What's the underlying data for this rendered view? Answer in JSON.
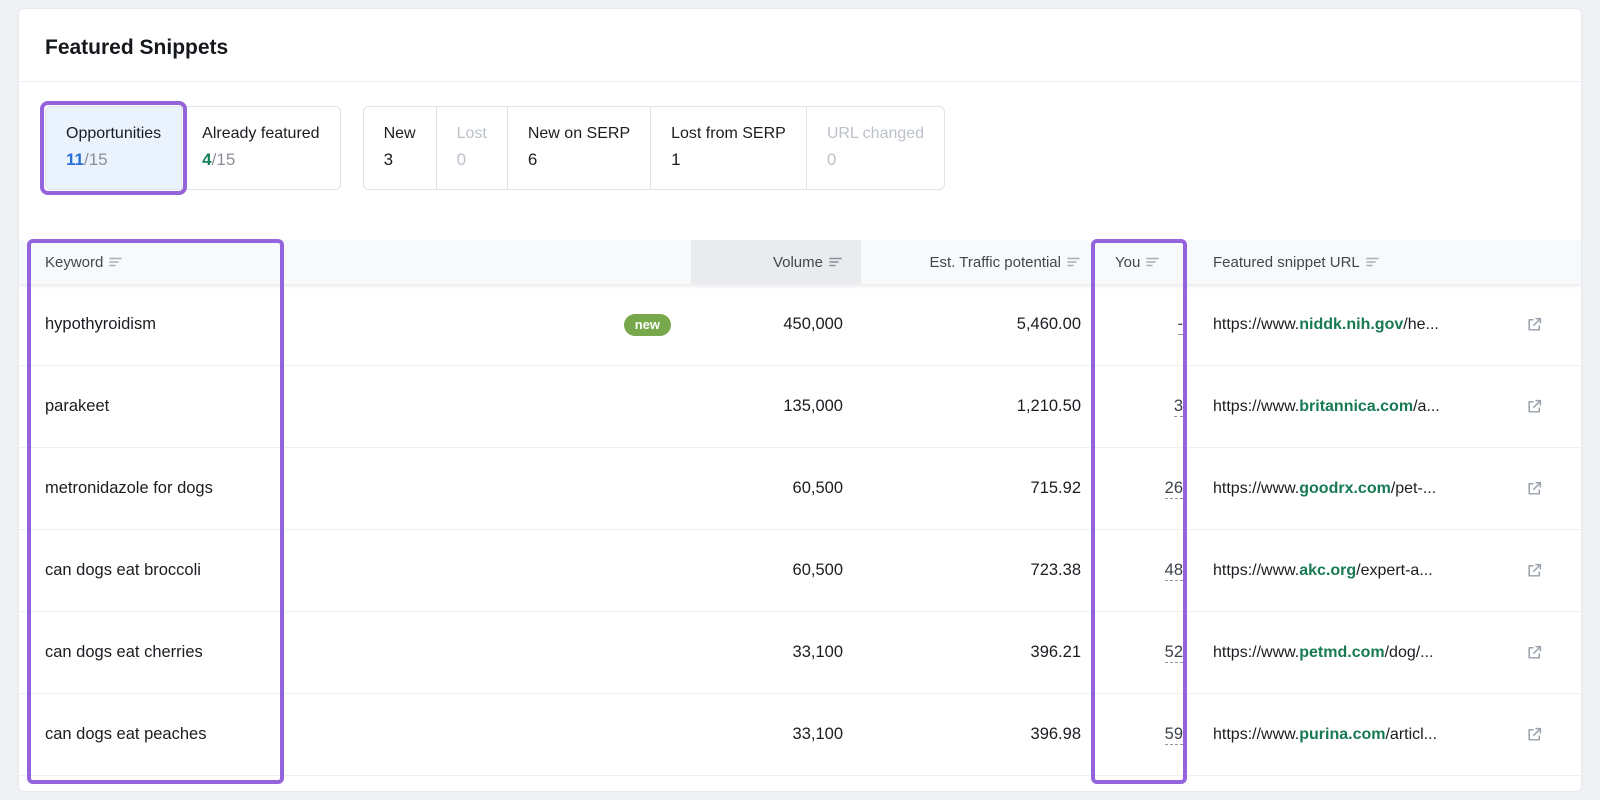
{
  "page": {
    "title": "Featured Snippets"
  },
  "tabs": [
    {
      "label": "Opportunities",
      "count": "11",
      "total": "/15"
    },
    {
      "label": "Already featured",
      "count": "4",
      "total": "/15"
    }
  ],
  "filters": [
    {
      "label": "New",
      "count": "3"
    },
    {
      "label": "Lost",
      "count": "0"
    },
    {
      "label": "New on SERP",
      "count": "6"
    },
    {
      "label": "Lost from SERP",
      "count": "1"
    },
    {
      "label": "URL changed",
      "count": "0"
    }
  ],
  "table": {
    "headers": {
      "keyword": "Keyword",
      "volume": "Volume",
      "traffic": "Est. Traffic potential",
      "you": "You",
      "url": "Featured snippet URL"
    },
    "rows": [
      {
        "keyword": "hypothyroidism",
        "badge": "new",
        "volume": "450,000",
        "traffic": "5,460.00",
        "you": "-",
        "url_prefix": "https://www.",
        "domain": "niddk.nih.gov",
        "path": "/he..."
      },
      {
        "keyword": "parakeet",
        "volume": "135,000",
        "traffic": "1,210.50",
        "you": "3",
        "url_prefix": "https://www.",
        "domain": "britannica.com",
        "path": "/a..."
      },
      {
        "keyword": "metronidazole for dogs",
        "volume": "60,500",
        "traffic": "715.92",
        "you": "26",
        "url_prefix": "https://www.",
        "domain": "goodrx.com",
        "path": "/pet-..."
      },
      {
        "keyword": "can dogs eat broccoli",
        "volume": "60,500",
        "traffic": "723.38",
        "you": "48",
        "url_prefix": "https://www.",
        "domain": "akc.org",
        "path": "/expert-a..."
      },
      {
        "keyword": "can dogs eat cherries",
        "volume": "33,100",
        "traffic": "396.21",
        "you": "52",
        "url_prefix": "https://www.",
        "domain": "petmd.com",
        "path": "/dog/..."
      },
      {
        "keyword": "can dogs eat peaches",
        "volume": "33,100",
        "traffic": "396.98",
        "you": "59",
        "url_prefix": "https://www.",
        "domain": "purina.com",
        "path": "/articl..."
      }
    ]
  },
  "colors": {
    "annotation-purple": "#9463DE",
    "count-blue": "#2A6FD6",
    "count-green": "#15835A",
    "badge-green": "#77A84B",
    "domain-green": "#177A52",
    "selected-tab-bg": "#EAF2FD",
    "disabled-text": "#BCC2CA"
  }
}
